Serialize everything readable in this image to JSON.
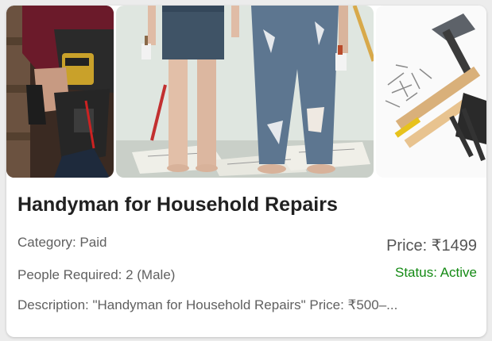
{
  "card": {
    "title": "Handyman for Household Repairs",
    "category": "Category: Paid",
    "people_required": "People Required: 2 (Male)",
    "description": "Description: \"Handyman for Household Repairs\" Price: ₹500–...",
    "price": "Price: ₹1499",
    "status_label": "Status: ",
    "status_value": "Active",
    "colors": {
      "status_active": "#148a14",
      "title": "#212121",
      "meta_text": "#606060"
    }
  },
  "gallery": {
    "images": [
      {
        "name": "tool-belt-photo"
      },
      {
        "name": "people-painting-photo"
      },
      {
        "name": "tools-photo"
      }
    ]
  }
}
